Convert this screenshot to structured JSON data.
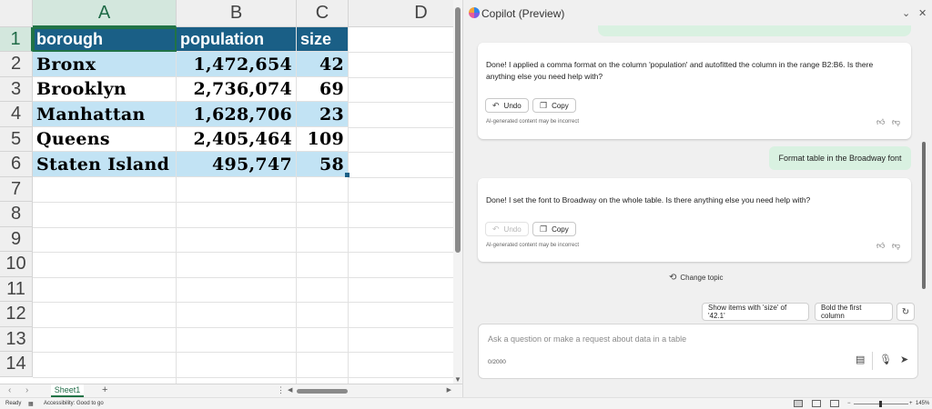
{
  "spreadsheet": {
    "columns": [
      "A",
      "B",
      "C",
      "D"
    ],
    "rows": [
      "1",
      "2",
      "3",
      "4",
      "5",
      "6",
      "7",
      "8",
      "9",
      "10",
      "11",
      "12",
      "13",
      "14"
    ],
    "header": [
      "borough",
      "population",
      "size"
    ],
    "data": [
      [
        "Bronx",
        "1,472,654",
        "42"
      ],
      [
        "Brooklyn",
        "2,736,074",
        "69"
      ],
      [
        "Manhattan",
        "1,628,706",
        "23"
      ],
      [
        "Queens",
        "2,405,464",
        "109"
      ],
      [
        "Staten Island",
        "495,747",
        "58"
      ]
    ],
    "selected_column": "A",
    "selected_row": "1",
    "sheet_tab": "Sheet1",
    "add_sheet": "+",
    "tab_prev": "‹",
    "tab_next": "›"
  },
  "status_bar": {
    "ready": "Ready",
    "accessibility": "Accessibility: Good to go",
    "zoom": "145%",
    "zoom_minus": "−",
    "zoom_plus": "+"
  },
  "copilot": {
    "title": "Copilot (Preview)",
    "messages": [
      {
        "text": "Done! I applied a comma format on the column 'population' and autofitted the column in the range B2:B6. Is there anything else you need help with?",
        "undo": "Undo",
        "copy": "Copy",
        "undo_enabled": true,
        "disclaimer": "AI-generated content may be incorrect"
      },
      {
        "text": "Done! I set the font to Broadway on the whole table. Is there anything else you need help with?",
        "undo": "Undo",
        "copy": "Copy",
        "undo_enabled": false,
        "disclaimer": "AI-generated content may be incorrect"
      }
    ],
    "user_message": "Format table in the Broadway font",
    "change_topic": "Change topic",
    "suggestions": [
      "Show items with 'size' of '42.1'",
      "Bold the first column"
    ],
    "input_placeholder": "Ask a question or make a request about data in a table",
    "char_count": "0/2000"
  },
  "colors": {
    "header_fill": "#1a5f86",
    "band_fill": "#c2e3f4",
    "excel_green": "#217346",
    "user_bubble": "#d9f1e1"
  }
}
